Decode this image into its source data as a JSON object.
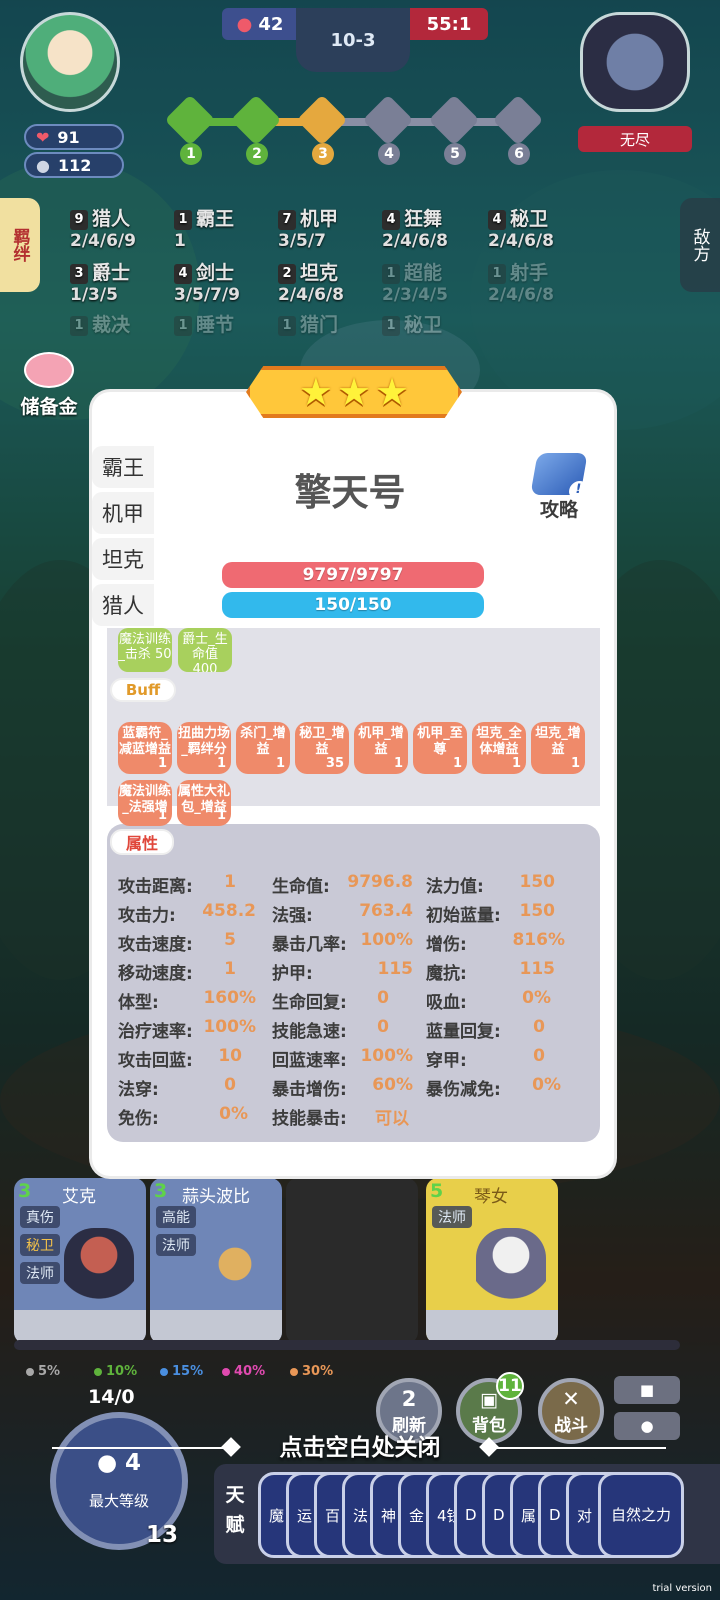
{
  "hud": {
    "hp": "91",
    "gold": "112",
    "score_left": "42",
    "stage": "10-3",
    "score_right": "55:1",
    "enemy_label": "无尽",
    "stage_steps": [
      "1",
      "2",
      "3",
      "4",
      "5",
      "6"
    ]
  },
  "tabs": {
    "synergy": "羁绊",
    "enemy": "敌方"
  },
  "synergies": [
    {
      "count": "9",
      "name": "猎人",
      "levels": "2/4/6/9"
    },
    {
      "count": "1",
      "name": "霸王",
      "levels": "1"
    },
    {
      "count": "7",
      "name": "机甲",
      "levels": "3/5/7"
    },
    {
      "count": "4",
      "name": "狂舞",
      "levels": "2/4/6/8"
    },
    {
      "count": "4",
      "name": "秘卫",
      "levels": "2/4/6/8"
    },
    {
      "count": "3",
      "name": "爵士",
      "levels": "1/3/5"
    },
    {
      "count": "4",
      "name": "剑士",
      "levels": "3/5/7/9"
    },
    {
      "count": "2",
      "name": "坦克",
      "levels": "2/4/6/8"
    },
    {
      "count": "1",
      "name": "超能",
      "levels": "2/3/4/5"
    },
    {
      "count": "1",
      "name": "射手",
      "levels": "2/4/6/8"
    },
    {
      "count": "1",
      "name": "裁决",
      "levels": ""
    },
    {
      "count": "1",
      "name": "睡节",
      "levels": ""
    },
    {
      "count": "1",
      "name": "猎门",
      "levels": ""
    },
    {
      "count": "1",
      "name": "秘卫",
      "levels": ""
    }
  ],
  "piggy_label": "储备金",
  "modal": {
    "stars": [
      "★",
      "★",
      "★"
    ],
    "side_tabs": [
      "霸王",
      "机甲",
      "坦克",
      "猎人"
    ],
    "unit_name": "擎天号",
    "guide_label": "攻略",
    "hp_bar": "9797/9797",
    "mp_bar": "150/150",
    "green_chips": [
      "魔法训练_击杀 50",
      "爵士_生命值 400"
    ],
    "buff_label": "Buff",
    "buffs": [
      {
        "name": "蓝霸符_减蓝增益",
        "count": "1"
      },
      {
        "name": "扭曲力场_羁绊分",
        "count": "1"
      },
      {
        "name": "杀门_增益",
        "count": "1"
      },
      {
        "name": "秘卫_增益",
        "count": "35"
      },
      {
        "name": "机甲_增益",
        "count": "1"
      },
      {
        "name": "机甲_至尊",
        "count": "1"
      },
      {
        "name": "坦克_全体增益",
        "count": "1"
      },
      {
        "name": "坦克_增益",
        "count": "1"
      },
      {
        "name": "魔法训练_法强增",
        "count": "1"
      },
      {
        "name": "属性大礼包_增益",
        "count": "1"
      }
    ],
    "attr_label": "属性",
    "attributes": [
      {
        "label": "攻击距离:",
        "value": "1"
      },
      {
        "label": "生命值:",
        "value": "9796.8"
      },
      {
        "label": "法力值:",
        "value": "150"
      },
      {
        "label": "攻击力:",
        "value": "458.2"
      },
      {
        "label": "法强:",
        "value": "763.4"
      },
      {
        "label": "初始蓝量:",
        "value": "150"
      },
      {
        "label": "攻击速度:",
        "value": "5"
      },
      {
        "label": "暴击几率:",
        "value": "100%"
      },
      {
        "label": "增伤:",
        "value": "816%"
      },
      {
        "label": "移动速度:",
        "value": "1"
      },
      {
        "label": "护甲:",
        "value": "115"
      },
      {
        "label": "魔抗:",
        "value": "115"
      },
      {
        "label": "体型:",
        "value": "160%"
      },
      {
        "label": "生命回复:",
        "value": "0"
      },
      {
        "label": "吸血:",
        "value": "0%"
      },
      {
        "label": "治疗速率:",
        "value": "100%"
      },
      {
        "label": "技能急速:",
        "value": "0"
      },
      {
        "label": "蓝量回复:",
        "value": "0"
      },
      {
        "label": "攻击回蓝:",
        "value": "10"
      },
      {
        "label": "回蓝速率:",
        "value": "100%"
      },
      {
        "label": "穿甲:",
        "value": "0"
      },
      {
        "label": "法穿:",
        "value": "0"
      },
      {
        "label": "暴击增伤:",
        "value": "60%"
      },
      {
        "label": "暴伤减免:",
        "value": "0%"
      },
      {
        "label": "免伤:",
        "value": "0%"
      },
      {
        "label": "技能暴击:",
        "value": "可以"
      }
    ]
  },
  "shop": {
    "cards": [
      {
        "cost": "3",
        "name": "艾克",
        "tags": [
          "真伤",
          "秘卫",
          "法师"
        ]
      },
      {
        "cost": "3",
        "name": "蒜头波比",
        "tags": [
          "高能",
          "法师"
        ]
      },
      {
        "cost": "5",
        "name": "琴女",
        "tags": [
          "法师"
        ]
      }
    ],
    "odds": [
      {
        "value": "5%",
        "color": "#a8a8a8"
      },
      {
        "value": "10%",
        "color": "#5fb33c"
      },
      {
        "value": "15%",
        "color": "#4a8fe0"
      },
      {
        "value": "40%",
        "color": "#e04ab0"
      },
      {
        "value": "30%",
        "color": "#e89757"
      }
    ],
    "refresh_cost": "2",
    "refresh_label": "刷新",
    "bag_label": "背包",
    "bag_count": "11",
    "fight_label": "战斗",
    "xp": "14/0",
    "level_cost": "4",
    "level_label": "最大等级",
    "level": "13"
  },
  "close_hint": "点击空白处关闭",
  "talent": {
    "label": "天赋",
    "cards": [
      "魔",
      "运",
      "百",
      "法",
      "神",
      "金",
      "4钱",
      "D",
      "D",
      "属",
      "D",
      "对"
    ],
    "last_card": "自然之力"
  },
  "watermark": "trial version"
}
